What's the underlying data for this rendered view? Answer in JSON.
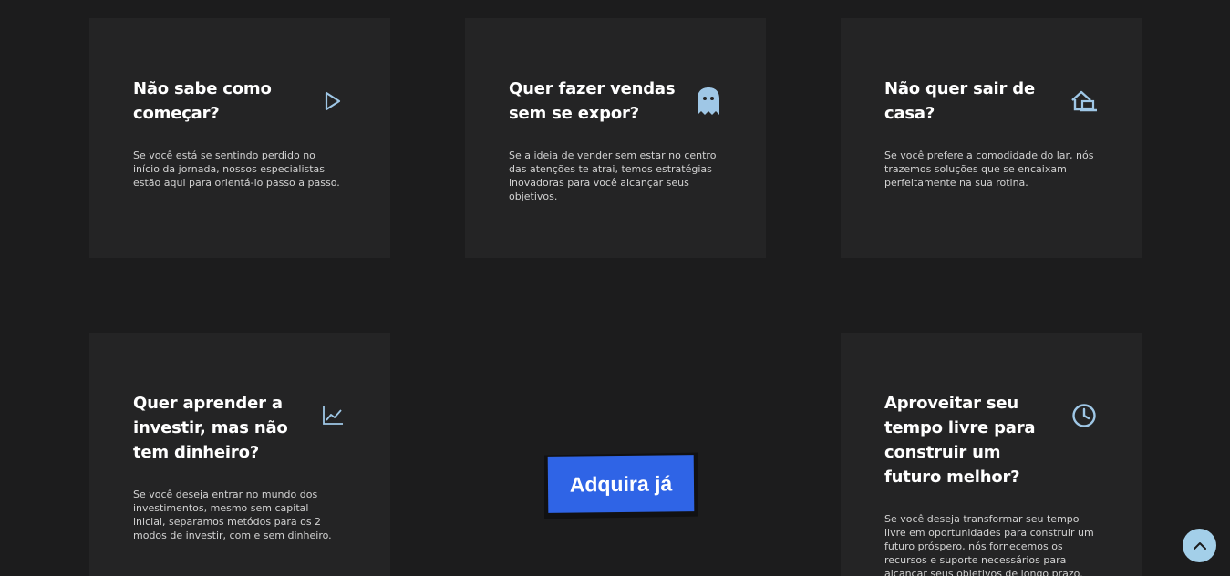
{
  "cards": [
    {
      "title": "Não sabe como começar?",
      "description": "Se você está se sentindo perdido no início da jornada, nossos especialistas estão aqui para orientá-lo passo a passo.",
      "icon": "play-icon"
    },
    {
      "title": "Quer fazer vendas sem se expor?",
      "description": "Se a ideia de vender sem estar no centro das atenções te atrai, temos estratégias inovadoras para você alcançar seus objetivos.",
      "icon": "ghost-icon"
    },
    {
      "title": "Não quer sair de casa?",
      "description": "Se você prefere a comodidade do lar, nós trazemos soluções que se encaixam perfeitamente na sua rotina.",
      "icon": "home-laptop-icon"
    },
    {
      "title": "Quer aprender a investir, mas não tem dinheiro?",
      "description": "Se você deseja entrar no mundo dos investimentos, mesmo sem capital inicial, separamos metódos para os 2 modos de investir, com e sem dinheiro.",
      "icon": "chart-line-icon"
    },
    {
      "title": "Aproveitar seu tempo livre para construir um futuro melhor?",
      "description": "Se você deseja transformar seu tempo livre em oportunidades para construir um futuro próspero, nós fornecemos os recursos e suporte necessários para alcançar seus objetivos de longo prazo.",
      "icon": "clock-icon"
    }
  ],
  "cta": {
    "label": "Adquira já"
  },
  "scroll_top": {
    "icon": "chevron-up-icon"
  },
  "colors": {
    "background": "#1c1c1d",
    "card": "#242425",
    "icon": "#9fc7e6",
    "cta": "#2f64e6",
    "scroll_top": "#a3cfe9"
  }
}
